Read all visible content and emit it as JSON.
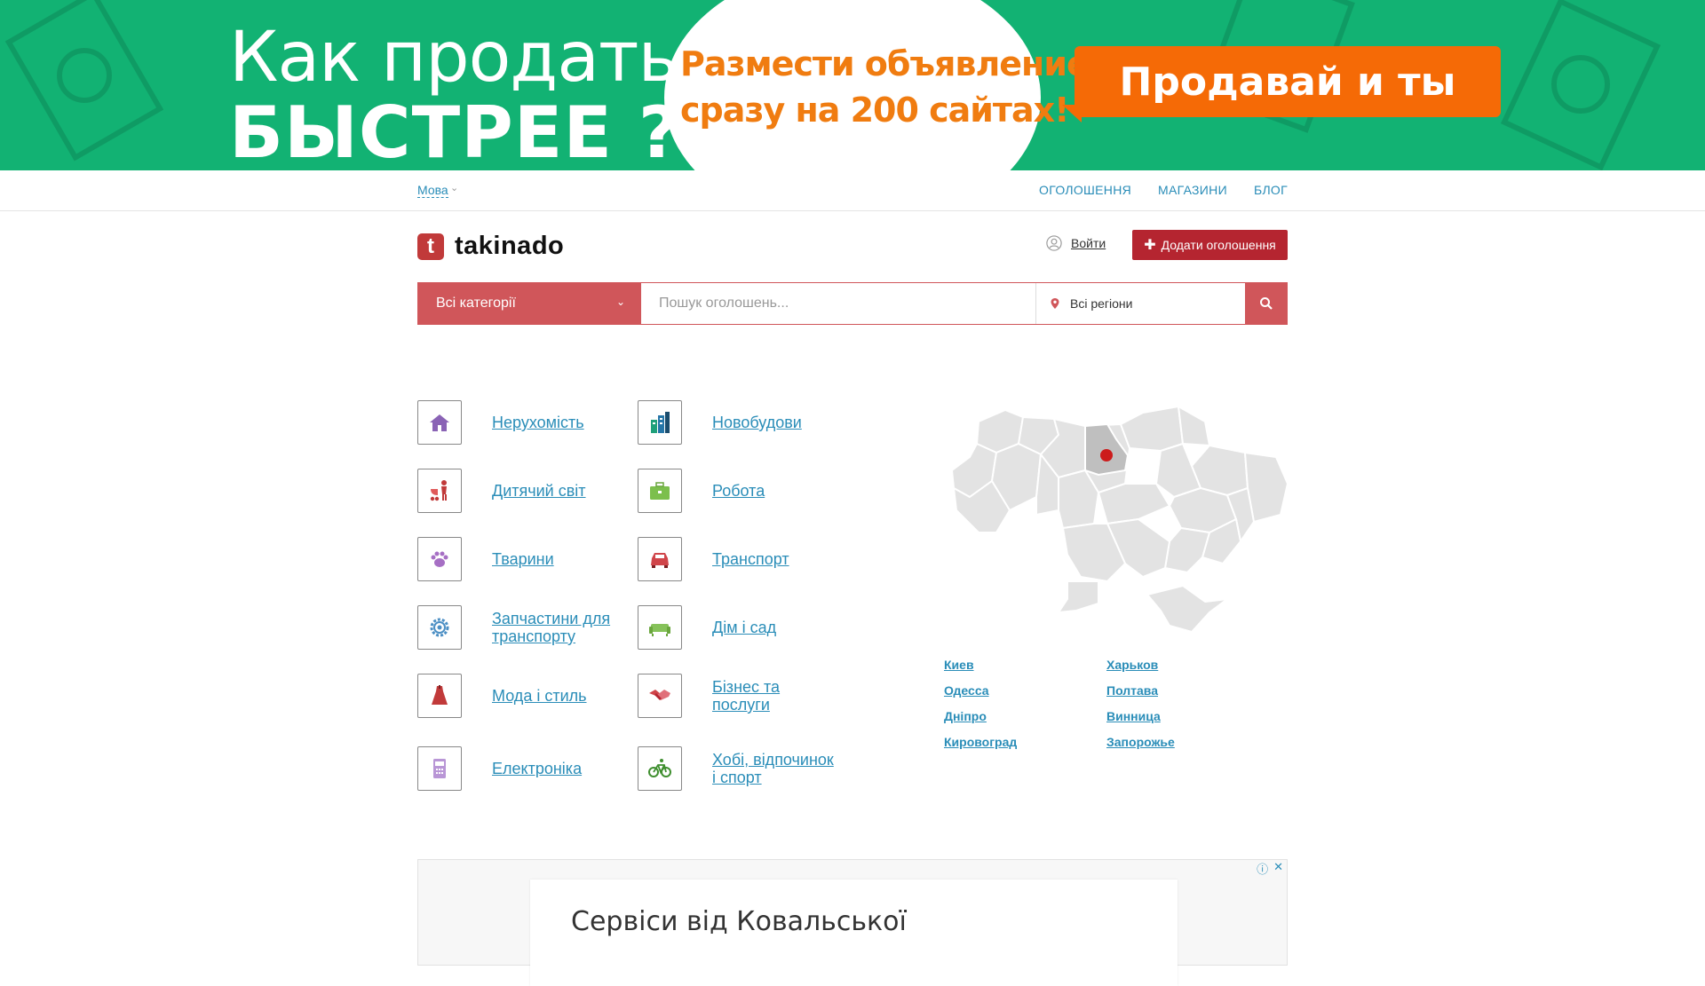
{
  "banner": {
    "headline_line1": "Как продать",
    "headline_line2": "БЫСТРЕЕ ?",
    "circle_line1": "Размести объявление",
    "circle_line2": "сразу на 200 сайтах!",
    "cta": "Продавай и ты",
    "bg_color": "#12b273",
    "cta_color": "#f56a06"
  },
  "topbar": {
    "lang": "Мова",
    "nav": [
      "ОГОЛОШЕННЯ",
      "МАГАЗИНИ",
      "БЛОГ"
    ]
  },
  "header": {
    "logo_mark": "t",
    "logo_text": "takinado",
    "login": "Войти",
    "add_button": "Додати оголошення",
    "accent": "#b52530"
  },
  "search": {
    "category": "Всі категорії",
    "placeholder": "Пошук оголошень...",
    "region": "Всі регіони"
  },
  "categories": [
    {
      "label": "Нерухомість",
      "icon": "house-icon"
    },
    {
      "label": "Новобудови",
      "icon": "buildings-icon"
    },
    {
      "label": "Дитячий світ",
      "icon": "stroller-icon"
    },
    {
      "label": "Робота",
      "icon": "briefcase-icon"
    },
    {
      "label": "Тварини",
      "icon": "paw-icon"
    },
    {
      "label": "Транспорт",
      "icon": "car-icon"
    },
    {
      "label": "Запчастини для транспорту",
      "icon": "gear-icon"
    },
    {
      "label": "Дім і сад",
      "icon": "sofa-icon"
    },
    {
      "label": "Мода і стиль",
      "icon": "dress-icon"
    },
    {
      "label": "Бізнес та послуги",
      "icon": "handshake-icon"
    },
    {
      "label": "Електроніка",
      "icon": "calculator-icon"
    },
    {
      "label": "Хобі, відпочинок і спорт",
      "icon": "bicycle-icon"
    }
  ],
  "cities": [
    "Киев",
    "Харьков",
    "Одесса",
    "Полтава",
    "Дніпро",
    "Винница",
    "Кировоград",
    "Запорожье"
  ],
  "ad": {
    "title": "Сервіси від Ковальської"
  }
}
